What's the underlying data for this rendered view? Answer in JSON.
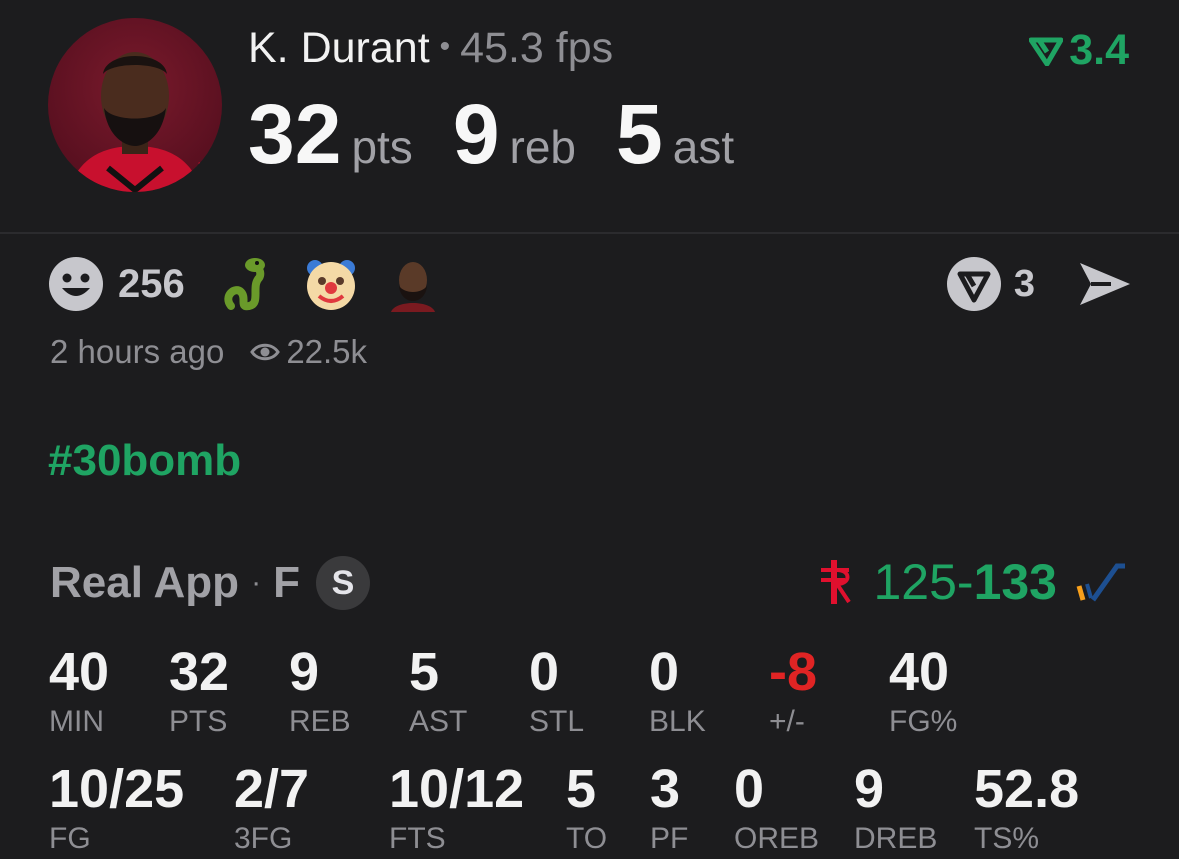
{
  "player": {
    "name": "K. Durant",
    "fps": "45.3 fps",
    "rating": "3.4",
    "stats": [
      {
        "value": "32",
        "unit": "pts"
      },
      {
        "value": "9",
        "unit": "reb"
      },
      {
        "value": "5",
        "unit": "ast"
      }
    ]
  },
  "post": {
    "reaction_count": "256",
    "comment_count": "3",
    "time_ago": "2 hours ago",
    "views": "22.5k",
    "hashtag": "#30bomb"
  },
  "game": {
    "source": "Real App",
    "separator": "·",
    "position": "F",
    "badge": "S",
    "score_home": "125",
    "score_dash": "-",
    "score_away": "133"
  },
  "boxscore_row1": [
    {
      "value": "40",
      "label": "MIN"
    },
    {
      "value": "32",
      "label": "PTS"
    },
    {
      "value": "9",
      "label": "REB"
    },
    {
      "value": "5",
      "label": "AST"
    },
    {
      "value": "0",
      "label": "STL"
    },
    {
      "value": "0",
      "label": "BLK"
    },
    {
      "value": "-8",
      "label": "+/-"
    },
    {
      "value": "40",
      "label": "FG%"
    }
  ],
  "boxscore_row2": [
    {
      "value": "10/25",
      "label": "FG"
    },
    {
      "value": "2/7",
      "label": "3FG"
    },
    {
      "value": "10/12",
      "label": "FTS"
    },
    {
      "value": "5",
      "label": "TO"
    },
    {
      "value": "3",
      "label": "PF"
    },
    {
      "value": "0",
      "label": "OREB"
    },
    {
      "value": "9",
      "label": "DREB"
    },
    {
      "value": "52.8",
      "label": "TS%"
    }
  ],
  "colors": {
    "background": "#1c1c1e",
    "accent_green": "#1fa463",
    "negative_red": "#e02424",
    "muted_text": "#8e8e93"
  },
  "icons": {
    "reaction": "smiley-face-icon",
    "emoji1": "snake-emoji-icon",
    "emoji2": "clown-emoji-icon",
    "emoji3": "player-face-emoji-icon",
    "rating": "real-logo-icon",
    "comment": "real-logo-icon",
    "share": "send-arrow-icon",
    "views": "eye-icon",
    "home_team": "rockets-logo-icon",
    "away_team": "jazz-logo-icon"
  }
}
